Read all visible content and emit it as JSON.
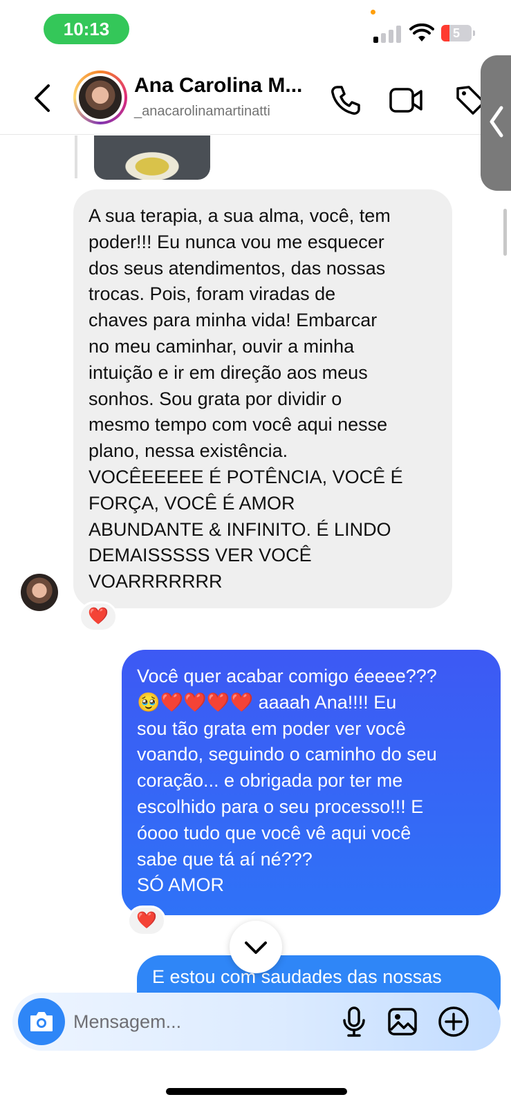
{
  "status_bar": {
    "time": "10:13",
    "battery_level": "5",
    "signal_bars_active": 1,
    "colors": {
      "time_pill": "#34c759",
      "battery_fill": "#ff3b30"
    }
  },
  "header": {
    "contact_name": "Ana Carolina M...",
    "contact_handle": "_anacarolinamartinatti",
    "icons": [
      "back-arrow-icon",
      "phone-icon",
      "video-camera-icon",
      "tag-icon",
      "chevron-left-icon"
    ]
  },
  "messages": [
    {
      "sender": "contact",
      "text": "A sua terapia, a sua alma, você, tem\npoder!!! Eu nunca vou me esquecer\ndos seus atendimentos, das nossas\ntrocas. Pois, foram viradas de\nchaves para minha vida! Embarcar\nno meu caminhar, ouvir a minha\nintuição e ir em direção aos meus\nsonhos. Sou grata por dividir o\nmesmo tempo com você aqui nesse\nplano, nessa existência.\nVOCÊEEEEE É POTÊNCIA, VOCÊ É\nFORÇA, VOCÊ É AMOR\nABUNDANTE & INFINITO. É LINDO\nDEMAISSSSS VER VOCÊ\nVOARRRRRRR",
      "reaction": "❤️"
    },
    {
      "sender": "me",
      "text": "Você quer acabar comigo éeeee???\n🥹❤️❤️❤️❤️ aaaah Ana!!!! Eu\nsou tão grata em poder ver você\nvoando, seguindo o caminho do seu\ncoração... e obrigada por ter me\nescolhido para o seu processo!!! E\nóooo tudo que você vê aqui você\nsabe que tá aí né???\nSÓ AMOR",
      "reaction": "❤️"
    },
    {
      "sender": "me",
      "text": "E estou com saudades das nossas"
    }
  ],
  "composer": {
    "placeholder": "Mensagem...",
    "icons": [
      "camera-icon",
      "microphone-icon",
      "gallery-icon",
      "plus-circle-icon"
    ]
  },
  "colors": {
    "incoming_bubble": "#efefef",
    "outgoing_bubble": "#3d59f4",
    "accent": "#2e86f7"
  }
}
